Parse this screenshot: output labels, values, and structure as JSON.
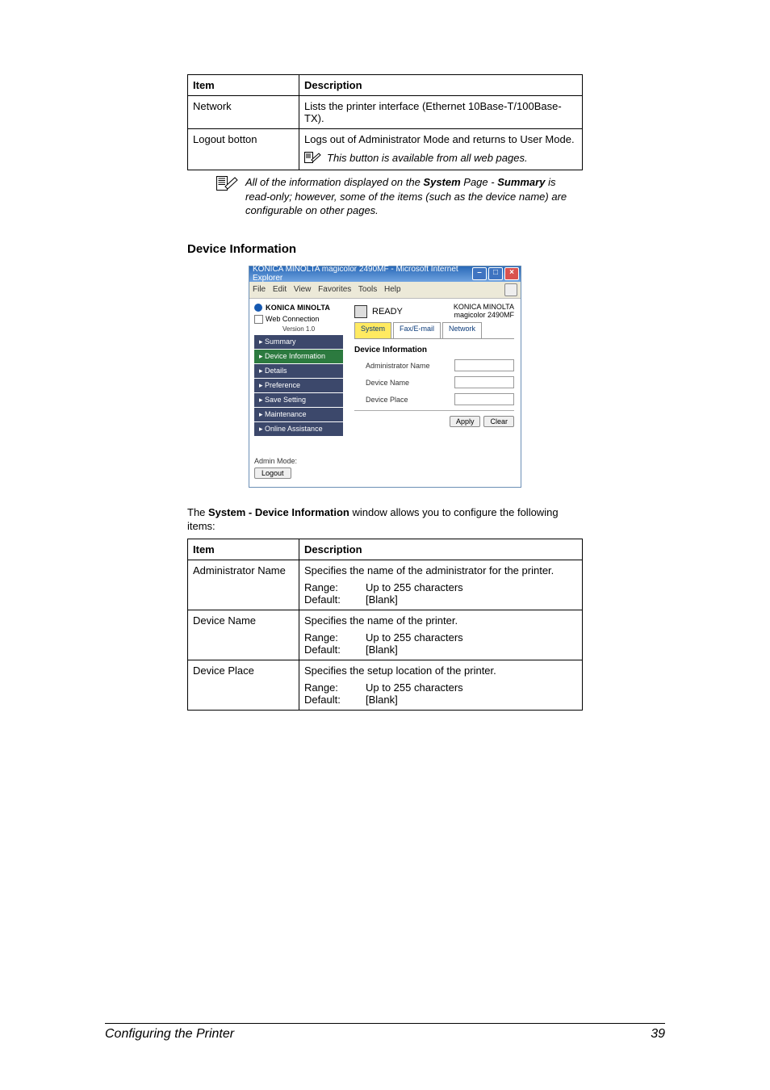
{
  "table1": {
    "col_item": "Item",
    "col_desc": "Description",
    "rows": [
      {
        "item": "Network",
        "desc": "Lists the printer interface (Ethernet 10Base-T/100Base-TX)."
      },
      {
        "item": "Logout botton",
        "desc": "Logs out of Administrator Mode and returns to User Mode.",
        "note": "This button is available from all web pages."
      }
    ]
  },
  "page_note": {
    "prefix": "All of the information displayed on the ",
    "bold1": "System",
    "mid1": " Page - ",
    "bold2": "Summary",
    "suffix": " is read-only; however, some of the items (such as the device name) are configurable on other pages."
  },
  "section_heading": "Device Information",
  "screenshot": {
    "window_title": "KONICA MINOLTA magicolor 2490MF - Microsoft Internet Explorer",
    "menu": "File   Edit   View   Favorites   Tools   Help",
    "brand": "KONICA MINOLTA",
    "web_connection": "Web Connection",
    "version": "Version 1.0",
    "nav": [
      "Summary",
      "Device Information",
      "Details",
      "Preference",
      "Save Setting",
      "Maintenance",
      "Online Assistance"
    ],
    "nav_selected_index": 1,
    "admin_mode": "Admin Mode:",
    "logout": "Logout",
    "ready": "READY",
    "printer_name_top": "KONICA MINOLTA",
    "printer_name_bottom": "magicolor 2490MF",
    "tabs": [
      "System",
      "Fax/E-mail",
      "Network"
    ],
    "active_tab_index": 0,
    "panel_title": "Device Information",
    "fields": [
      "Administrator Name",
      "Device Name",
      "Device Place"
    ],
    "apply": "Apply",
    "clear": "Clear"
  },
  "intro": {
    "pre": "The ",
    "bold": "System - Device Information",
    "post": " window allows you to configure the following items:"
  },
  "table2": {
    "col_item": "Item",
    "col_desc": "Description",
    "rows": [
      {
        "item": "Administrator Name",
        "desc": "Specifies the name of the administrator for the printer.",
        "range_lbl": "Range:",
        "range_val": "Up to 255 characters",
        "default_lbl": "Default:",
        "default_val": "[Blank]"
      },
      {
        "item": "Device Name",
        "desc": "Specifies the name of the printer.",
        "range_lbl": "Range:",
        "range_val": "Up to 255 characters",
        "default_lbl": "Default:",
        "default_val": "[Blank]"
      },
      {
        "item": "Device Place",
        "desc": "Specifies the setup location of the printer.",
        "range_lbl": "Range:",
        "range_val": "Up to 255 characters",
        "default_lbl": "Default:",
        "default_val": "[Blank]"
      }
    ]
  },
  "footer_title": "Configuring the Printer",
  "footer_page": "39"
}
